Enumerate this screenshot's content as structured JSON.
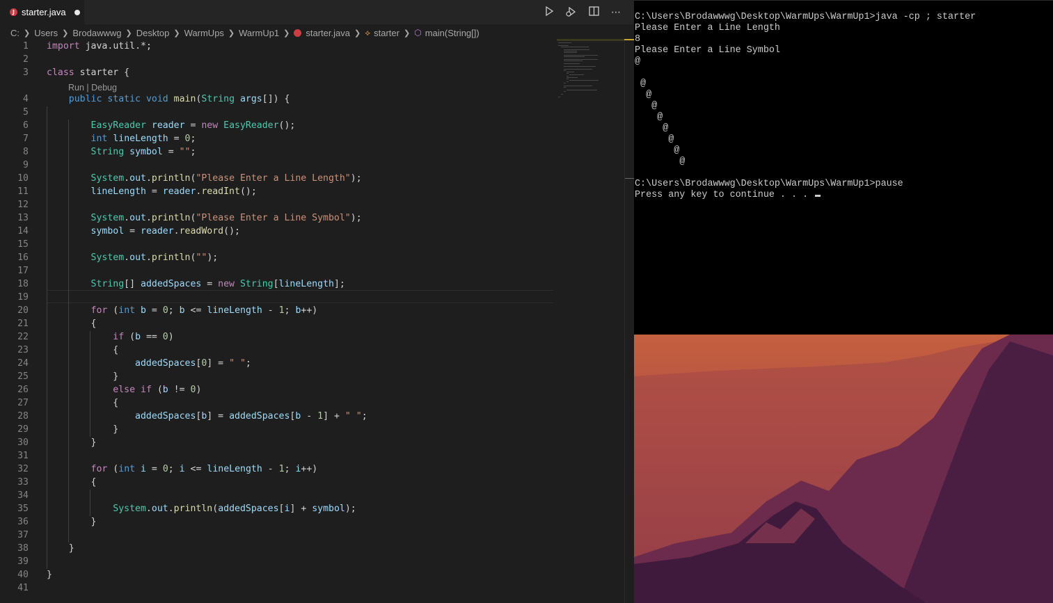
{
  "editor": {
    "tab": {
      "filename": "starter.java",
      "icon": "java-file-icon"
    },
    "toolbar": {
      "run": "run-icon",
      "debug": "debug-icon",
      "split": "split-editor-icon",
      "more": "more-actions-icon"
    },
    "breadcrumb": {
      "drive": "C:",
      "folders": [
        "Users",
        "Brodawwwg",
        "Desktop",
        "WarmUps",
        "WarmUp1"
      ],
      "file": "starter.java",
      "class_name": "starter",
      "method": "main(String[])"
    },
    "codelens": "Run | Debug",
    "line_numbers": [
      "1",
      "2",
      "3",
      "4",
      "5",
      "6",
      "7",
      "8",
      "9",
      "10",
      "11",
      "12",
      "13",
      "14",
      "15",
      "16",
      "17",
      "18",
      "19",
      "20",
      "21",
      "22",
      "23",
      "24",
      "25",
      "26",
      "27",
      "28",
      "29",
      "30",
      "31",
      "32",
      "33",
      "34",
      "35",
      "36",
      "37",
      "38",
      "39",
      "40",
      "41"
    ],
    "lines": [
      "import java.util.*;",
      "",
      "class starter {",
      "    public static void main(String args[]) {",
      "",
      "        EasyReader reader = new EasyReader();",
      "        int lineLength = 0;",
      "        String symbol = \"\";",
      "",
      "        System.out.println(\"Please Enter a Line Length\");",
      "        lineLength = reader.readInt();",
      "",
      "        System.out.println(\"Please Enter a Line Symbol\");",
      "        symbol = reader.readWord();",
      "",
      "        System.out.println(\"\");",
      "",
      "        String[] addedSpaces = new String[lineLength];",
      "",
      "        for (int b = 0; b <= lineLength - 1; b++)",
      "        {",
      "            if (b == 0)",
      "            {",
      "                addedSpaces[0] = \" \";",
      "            }",
      "            else if (b != 0)",
      "            {",
      "                addedSpaces[b] = addedSpaces[b - 1] + \" \";",
      "            }",
      "        }",
      "",
      "        for (int i = 0; i <= lineLength - 1; i++)",
      "        {",
      "",
      "            System.out.println(addedSpaces[i] + symbol);",
      "        }",
      "",
      "    }",
      "",
      "}",
      ""
    ]
  },
  "terminal": {
    "lines": [
      "C:\\Users\\Brodawwwg\\Desktop\\WarmUps\\WarmUp1>java -cp ; starter",
      "Please Enter a Line Length",
      "8",
      "Please Enter a Line Symbol",
      "@",
      "",
      " @",
      "  @",
      "   @",
      "    @",
      "     @",
      "      @",
      "       @",
      "        @",
      "",
      "C:\\Users\\Brodawwwg\\Desktop\\WarmUps\\WarmUp1>pause",
      "Press any key to continue . . . "
    ]
  },
  "colors": {
    "editor_bg": "#1e1e1e",
    "keyword": "#c586c0",
    "type_keyword": "#569cd6",
    "type": "#4ec9b0",
    "variable": "#9cdcfe",
    "function": "#dcdcaa",
    "string": "#ce9178",
    "number": "#b5cea8",
    "terminal_bg": "#000000",
    "terminal_text": "#cccccc"
  }
}
